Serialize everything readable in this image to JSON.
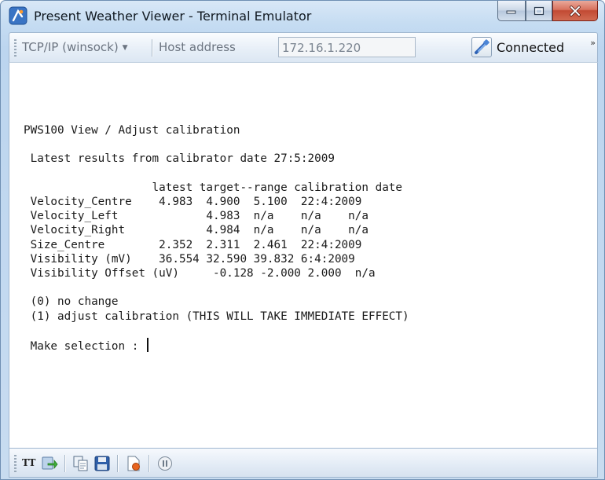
{
  "window": {
    "title": "Present Weather Viewer - Terminal Emulator"
  },
  "toolbar": {
    "connection_type": "TCP/IP (winsock)",
    "host_label": "Host address",
    "host_value": "172.16.1.220",
    "status": "Connected",
    "overflow": "»"
  },
  "terminal": {
    "lines": [
      "PWS100 View / Adjust calibration",
      "",
      " Latest results from calibrator date 27:5:2009",
      "",
      "                   latest target--range calibration date",
      " Velocity_Centre    4.983  4.900  5.100  22:4:2009",
      " Velocity_Left             4.983  n/a    n/a    n/a",
      " Velocity_Right            4.984  n/a    n/a    n/a",
      " Size_Centre        2.352  2.311  2.461  22:4:2009",
      " Visibility (mV)    36.554 32.590 39.832 6:4:2009",
      " Visibility Offset (uV)     -0.128 -2.000 2.000  n/a",
      "",
      " (0) no change",
      " (1) adjust calibration (THIS WILL TAKE IMMEDIATE EFFECT)",
      "",
      " Make selection : "
    ]
  },
  "bottombar": {
    "tt_label": "TT",
    "icons": [
      "send-icon",
      "copy-icon",
      "save-icon",
      "record-icon",
      "pause-icon"
    ]
  },
  "colors": {
    "titlebar": "#c5dcf2",
    "close_button": "#c24a33",
    "terminal_bg": "#ffffff"
  }
}
